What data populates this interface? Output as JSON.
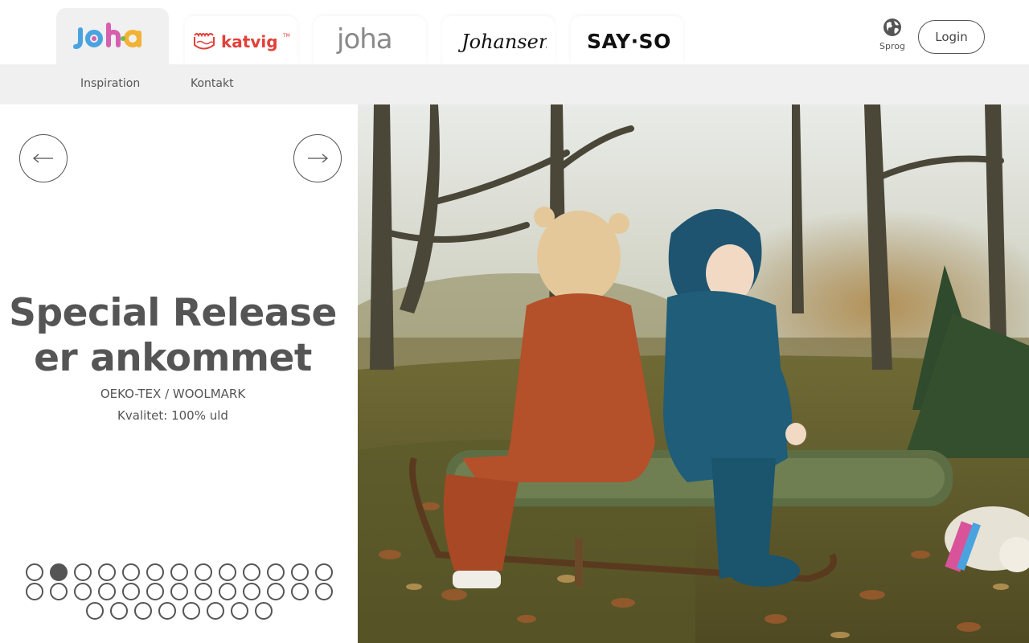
{
  "brands": [
    {
      "name": "joha"
    },
    {
      "name": "katvig"
    },
    {
      "name": "joha"
    },
    {
      "name": "Johansen"
    },
    {
      "name": "SAY·SO"
    }
  ],
  "language": {
    "label": "Sprog",
    "icon": "globe-icon"
  },
  "login": {
    "label": "Login"
  },
  "nav": [
    {
      "label": "Inspiration"
    },
    {
      "label": "Kontakt"
    }
  ],
  "hero": {
    "title_line1": "Special Release",
    "title_line2": "er ankommet",
    "subtitle1": "OEKO-TEX / WOOLMARK",
    "subtitle2": "Kvalitet: 100% uld",
    "prev_icon": "arrow-left-icon",
    "next_icon": "arrow-right-icon",
    "slide_count": 34,
    "active_slide": 2,
    "image_alt": "Two toddlers in wool suits sitting on a wooden sled covered with a green blanket in an autumn forest"
  },
  "colors": {
    "text": "#555555",
    "nav_bg": "#f0f0f0",
    "katvig_red": "#e2403a",
    "joha_blue": "#4aa3df",
    "joha_pink": "#d65fb0",
    "joha_yellow": "#f2b233"
  }
}
